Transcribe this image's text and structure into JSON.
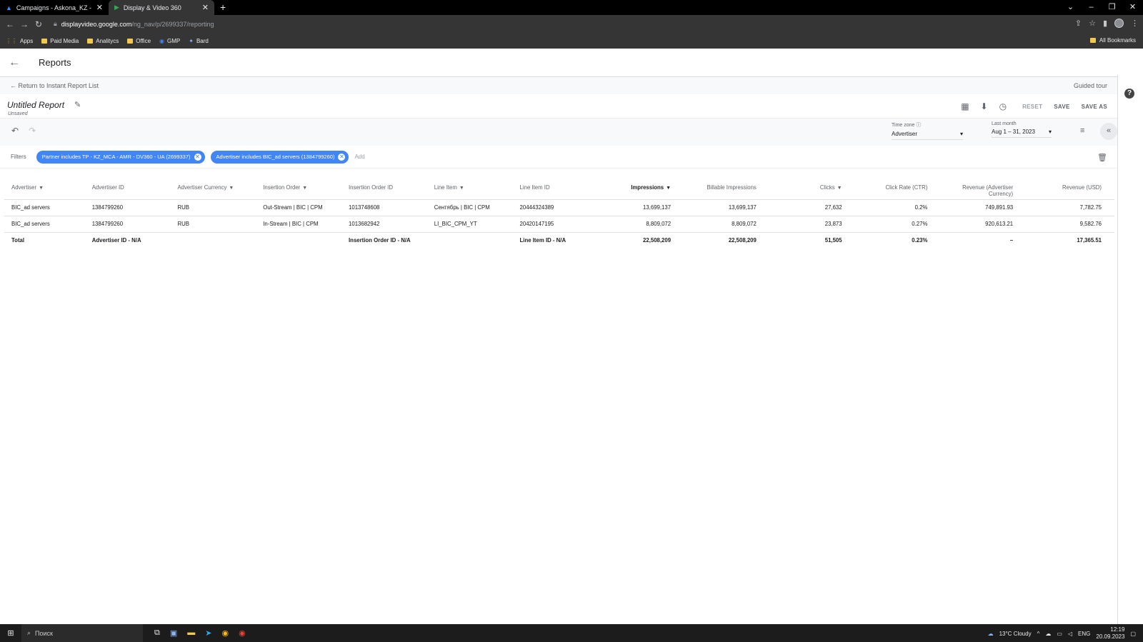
{
  "browser": {
    "tabs": [
      {
        "title": "Campaigns - Askona_KZ - Googl",
        "active": false
      },
      {
        "title": "Display & Video 360",
        "active": true
      }
    ],
    "url_host": "displayvideo.google.com",
    "url_path": "/ng_nav/p/2699337/reporting",
    "bookmarks": [
      "Apps",
      "Paid Media",
      "Analitycs",
      "Office",
      "GMP",
      "Bard"
    ],
    "all_bookmarks": "All Bookmarks"
  },
  "header": {
    "title": "Reports"
  },
  "breadcrumb": {
    "back_link": "← Return to Instant Report List",
    "guided_tour": "Guided tour"
  },
  "report": {
    "name": "Untitled Report",
    "status": "Unsaved",
    "reset": "RESET",
    "save": "SAVE",
    "save_as": "SAVE AS"
  },
  "options": {
    "timezone_label": "Time zone",
    "timezone_value": "Advertiser",
    "date_label": "Last month",
    "date_value": "Aug 1 – 31, 2023"
  },
  "filters": {
    "label": "Filters",
    "chips": [
      "Partner includes TP - KZ_MCA - AMR - DV360 - UA (2699337)",
      "Advertiser includes BIC_ad servers (1384799260)"
    ],
    "add": "Add"
  },
  "table": {
    "headers": [
      "Advertiser",
      "Advertiser ID",
      "Advertiser Currency",
      "Insertion Order",
      "Insertion Order ID",
      "Line Item",
      "Line Item ID",
      "Impressions",
      "Billable Impressions",
      "Clicks",
      "Click Rate (CTR)",
      "Revenue (Advertiser Currency)",
      "Revenue (USD)"
    ],
    "rows": [
      [
        "BIC_ad servers",
        "1384799260",
        "RUB",
        "Out-Stream | BIC | CPM",
        "1013748608",
        "Сентябрь | BIC | CPM",
        "20444324389",
        "13,699,137",
        "13,699,137",
        "27,632",
        "0.2%",
        "749,891.93",
        "7,782.75"
      ],
      [
        "BIC_ad servers",
        "1384799260",
        "RUB",
        "In-Stream | BIC | CPM",
        "1013682942",
        "LI_BIC_CPM_YT",
        "20420147195",
        "8,809,072",
        "8,809,072",
        "23,873",
        "0.27%",
        "920,613.21",
        "9,582.76"
      ]
    ],
    "total": [
      "Total",
      "Advertiser ID - N/A",
      "",
      "",
      "Insertion Order ID - N/A",
      "",
      "Line Item ID - N/A",
      "22,508,209",
      "22,508,209",
      "51,505",
      "0.23%",
      "–",
      "17,365.51"
    ]
  },
  "taskbar": {
    "search": "Поиск",
    "weather": "13°C Cloudy",
    "lang": "ENG",
    "time": "12:19",
    "date": "20.09.2023"
  }
}
